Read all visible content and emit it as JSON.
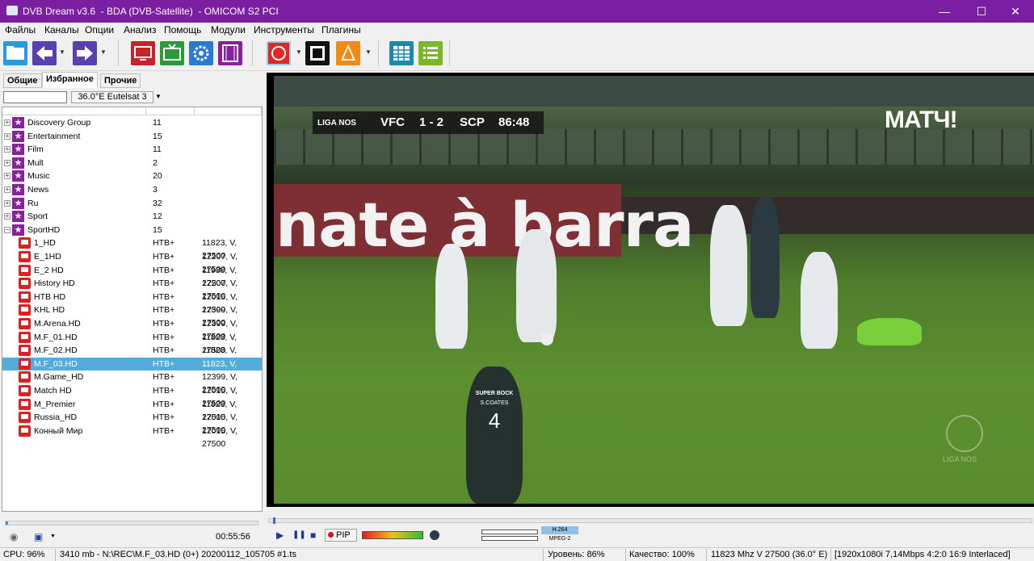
{
  "window": {
    "title": "DVB Dream v3.6  - BDA (DVB-Satellite)  - OMICOM S2 PCI",
    "minimize": "—",
    "maximize": "☐",
    "close": "✕",
    "accent_color": "#7a1fa2"
  },
  "menu": [
    "Файлы",
    "Каналы",
    "Опции",
    "Анализ",
    "Помощь",
    "Модули",
    "Инструменты",
    "Плагины"
  ],
  "toolbar": {
    "icons": [
      "open-folder-icon",
      "back-arrow-icon",
      "forward-arrow-icon",
      "monitor-icon",
      "tv-icon",
      "settings-gear-icon",
      "film-icon",
      "record-icon",
      "stop-square-icon",
      "vlc-cone-icon",
      "grid-icon",
      "list-icon"
    ]
  },
  "left_panel": {
    "tabs": [
      "Общие",
      "Избранное",
      "Прочие"
    ],
    "active_tab": "Избранное",
    "filter_value": "",
    "satellite": "36.0°E Eutelsat 3",
    "groups": [
      {
        "name": "Discovery Group",
        "count": "11",
        "expanded": "+"
      },
      {
        "name": "Entertainment",
        "count": "15",
        "expanded": "+"
      },
      {
        "name": "Film",
        "count": "11",
        "expanded": "+"
      },
      {
        "name": "Mult",
        "count": "2",
        "expanded": "+"
      },
      {
        "name": "Music",
        "count": "20",
        "expanded": "+"
      },
      {
        "name": "News",
        "count": "3",
        "expanded": "+"
      },
      {
        "name": "Ru",
        "count": "32",
        "expanded": "+"
      },
      {
        "name": "Sport",
        "count": "12",
        "expanded": "+"
      },
      {
        "name": "SportHD",
        "count": "15",
        "expanded": "−"
      }
    ],
    "channels": [
      {
        "name": "1_HD",
        "provider": "НТВ+",
        "tp": "11823, V, 27500"
      },
      {
        "name": "E_1HD",
        "provider": "НТВ+",
        "tp": "12207, V, 27500"
      },
      {
        "name": "E_2 HD",
        "provider": "НТВ+",
        "tp": "11938, V, 27500"
      },
      {
        "name": "History HD",
        "provider": "НТВ+",
        "tp": "12207, V, 27500"
      },
      {
        "name": "НТВ HD",
        "provider": "НТВ+",
        "tp": "12015, V, 27500"
      },
      {
        "name": "KHL HD",
        "provider": "НТВ+",
        "tp": "12399, V, 27500"
      },
      {
        "name": "M.Arena.HD",
        "provider": "НТВ+",
        "tp": "12399, V, 27500"
      },
      {
        "name": "M.F_01.HD",
        "provider": "НТВ+",
        "tp": "11823, V, 27500"
      },
      {
        "name": "M.F_02.HD",
        "provider": "НТВ+",
        "tp": "11823, V, 27500"
      },
      {
        "name": "M.F_03.HD",
        "provider": "НТВ+",
        "tp": "11823, V, 27500"
      },
      {
        "name": "M.Game_HD",
        "provider": "НТВ+",
        "tp": "12399, V, 27500"
      },
      {
        "name": "Match HD",
        "provider": "НТВ+",
        "tp": "12015, V, 27500"
      },
      {
        "name": "M_Premier",
        "provider": "НТВ+",
        "tp": "11823, V, 27500"
      },
      {
        "name": "Russia_HD",
        "provider": "НТВ+",
        "tp": "12015, V, 27500"
      },
      {
        "name": "Конный Мир",
        "provider": "НТВ+",
        "tp": "12015, V, 27500"
      }
    ],
    "selected_channel": "M.F_03.HD",
    "record_time": "00:55:56",
    "record_progress": 0.01,
    "selection_color": "#55acd8"
  },
  "video": {
    "scorebug": {
      "league": "LIGA NOS",
      "home": "VFC",
      "score": "1 - 2",
      "away": "SCP",
      "clock": "86:48"
    },
    "channel_logo": "МАТЧ!",
    "banner_text": "nate à barra",
    "player_shirt": "SUPER BOCK",
    "player_name": "S.COATES",
    "player_number": "4",
    "watermark": "LIGA NOS"
  },
  "controls": {
    "play": "▶",
    "pause": "❚❚",
    "stop": "■",
    "pip_label": "PIP",
    "codec_video": "H.264",
    "codec_mpeg": "MPEG-2",
    "seek_progress": 0.003
  },
  "status": {
    "cpu": "CPU: 96%",
    "rec": "3410 mb - N:\\REC\\M.F_03.HD (0+) 20200112_105705 #1.ts",
    "level": "Уровень: 86%",
    "quality": "Качество: 100%",
    "freq": "11823 Mhz  V  27500  (36.0° E)",
    "video_info": "[1920x1080i  7,14Mbps 4:2:0  16:9 Interlaced]"
  }
}
